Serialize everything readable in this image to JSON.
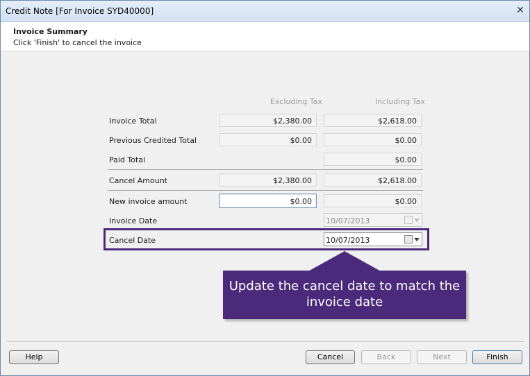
{
  "window": {
    "title": "Credit Note [For Invoice SYD40000]",
    "close_glyph": "✕"
  },
  "header": {
    "title": "Invoice Summary",
    "subtitle": "Click 'Finish' to cancel the invoice"
  },
  "columns": {
    "excluding_tax": "Excluding Tax",
    "including_tax": "Including Tax"
  },
  "rows": {
    "invoice_total": {
      "label": "Invoice Total",
      "excl": "$2,380.00",
      "incl": "$2,618.00"
    },
    "previous_credited": {
      "label": "Previous Credited Total",
      "excl": "$0.00",
      "incl": "$0.00"
    },
    "paid_total": {
      "label": "Paid Total",
      "incl": "$0.00"
    },
    "cancel_amount": {
      "label": "Cancel Amount",
      "excl": "$2,380.00",
      "incl": "$2,618.00"
    },
    "new_invoice_amount": {
      "label": "New invoice amount",
      "excl": "$0.00",
      "incl": "$0.00"
    }
  },
  "invoice_date": {
    "label": "Invoice Date",
    "value": "10/07/2013"
  },
  "cancel_date": {
    "label": "Cancel Date",
    "value": "10/07/2013"
  },
  "callout": {
    "text": "Update the cancel date to match the invoice date"
  },
  "buttons": {
    "help": "Help",
    "cancel": "Cancel",
    "back": "Back",
    "next": "Next",
    "finish": "Finish"
  },
  "colors": {
    "callout": "#4b2a7b",
    "highlight_border": "#4b2a7b"
  },
  "icons": {
    "calendar": "calendar-icon",
    "dropdown": "dropdown-arrow-icon",
    "close": "close-icon"
  }
}
